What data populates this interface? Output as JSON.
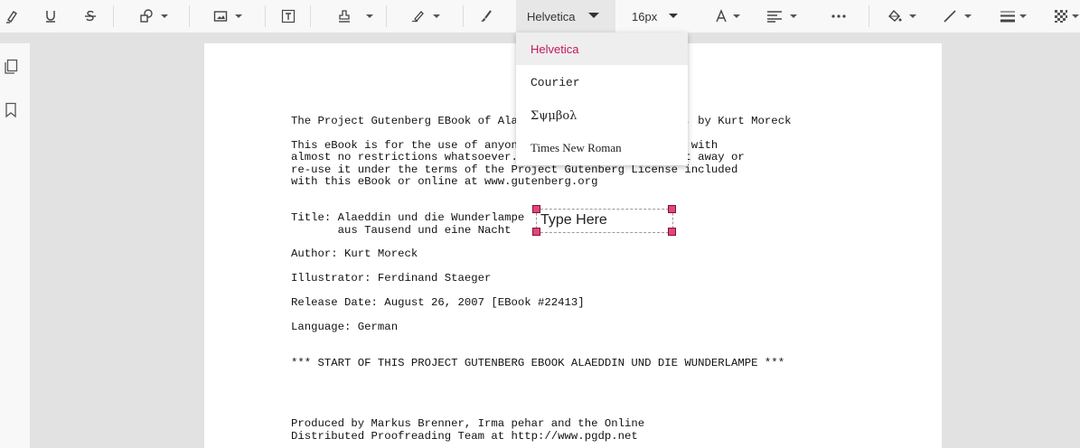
{
  "toolbar": {
    "font_family": "Helvetica",
    "font_size": "16px",
    "icons": [
      "highlight-icon",
      "underline-icon",
      "strikethrough-icon",
      "shapes-icon",
      "image-icon",
      "free-text-icon",
      "stamp-icon",
      "signature-icon",
      "ink-pen-icon",
      "font-color-icon",
      "text-align-icon",
      "more-icon",
      "fill-color-icon",
      "stroke-color-icon",
      "line-thickness-icon",
      "opacity-icon"
    ]
  },
  "font_dropdown": {
    "options": [
      "Helvetica",
      "Courier",
      "Σψμβολ",
      "Times New Roman"
    ],
    "selected": "Helvetica",
    "selected_color": "#c2185b"
  },
  "text_box": {
    "placeholder": "Type Here"
  },
  "document": {
    "lines": [
      "The Project Gutenberg EBook of Alaeddin und die Wunderlampe, by Kurt Moreck",
      "",
      "This eBook is for the use of anyone anywhere at no cost and with",
      "almost no restrictions whatsoever.  You may copy it, give it away or",
      "re-use it under the terms of the Project Gutenberg License included",
      "with this eBook or online at www.gutenberg.org",
      "",
      "",
      "Title: Alaeddin und die Wunderlampe",
      "       aus Tausend und eine Nacht",
      "",
      "Author: Kurt Moreck",
      "",
      "Illustrator: Ferdinand Staeger",
      "",
      "Release Date: August 26, 2007 [EBook #22413]",
      "",
      "Language: German",
      "",
      "",
      "*** START OF THIS PROJECT GUTENBERG EBOOK ALAEDDIN UND DIE WUNDERLAMPE ***",
      "",
      "",
      "",
      "",
      "Produced by Markus Brenner, Irma pehar and the Online",
      "Distributed Proofreading Team at http://www.pgdp.net"
    ]
  }
}
